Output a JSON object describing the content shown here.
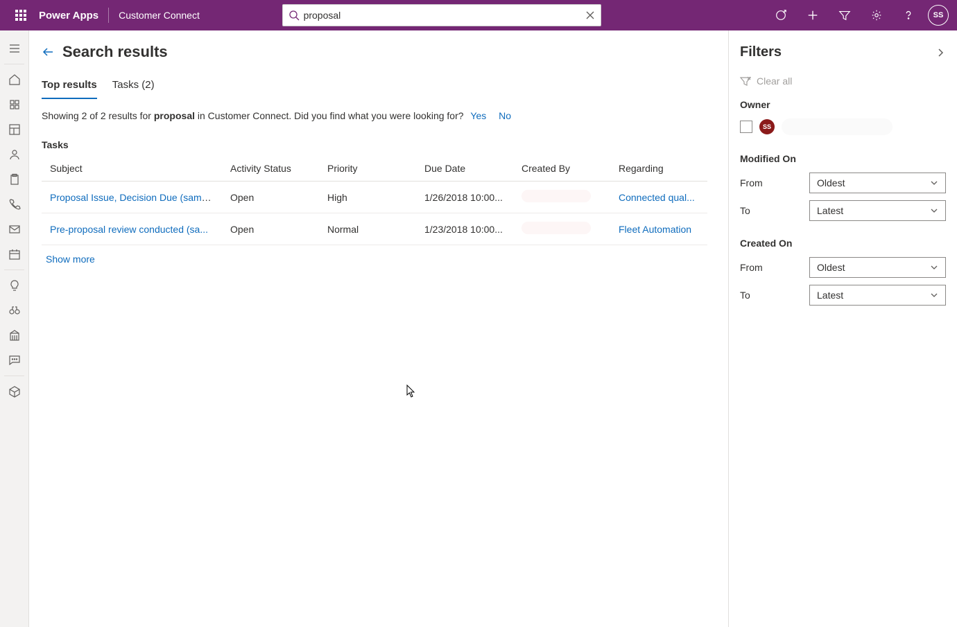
{
  "header": {
    "brand": "Power Apps",
    "app_name": "Customer Connect",
    "search_value": "proposal",
    "avatar_initials": "SS"
  },
  "page": {
    "title": "Search results",
    "tabs": [
      {
        "label": "Top results",
        "active": true
      },
      {
        "label": "Tasks (2)",
        "active": false
      }
    ],
    "summary": {
      "prefix": "Showing 2 of 2 results for ",
      "term": "proposal",
      "suffix": " in Customer Connect. Did you find what you were looking for?",
      "yes": "Yes",
      "no": "No"
    },
    "section_label": "Tasks",
    "columns": {
      "subject": "Subject",
      "activity_status": "Activity Status",
      "priority": "Priority",
      "due_date": "Due Date",
      "created_by": "Created By",
      "regarding": "Regarding"
    },
    "rows": [
      {
        "subject": "Proposal Issue, Decision Due (sampl...",
        "activity_status": "Open",
        "priority": "High",
        "due_date": "1/26/2018 10:00...",
        "created_by": "",
        "regarding": "Connected qual..."
      },
      {
        "subject": "Pre-proposal review conducted (sa...",
        "activity_status": "Open",
        "priority": "Normal",
        "due_date": "1/23/2018 10:00...",
        "created_by": "",
        "regarding": "Fleet Automation"
      }
    ],
    "show_more": "Show more"
  },
  "filters": {
    "title": "Filters",
    "clear_all": "Clear all",
    "owner": {
      "label": "Owner",
      "initials": "SS"
    },
    "modified_on": {
      "label": "Modified On",
      "from_label": "From",
      "from_value": "Oldest",
      "to_label": "To",
      "to_value": "Latest"
    },
    "created_on": {
      "label": "Created On",
      "from_label": "From",
      "from_value": "Oldest",
      "to_label": "To",
      "to_value": "Latest"
    }
  }
}
